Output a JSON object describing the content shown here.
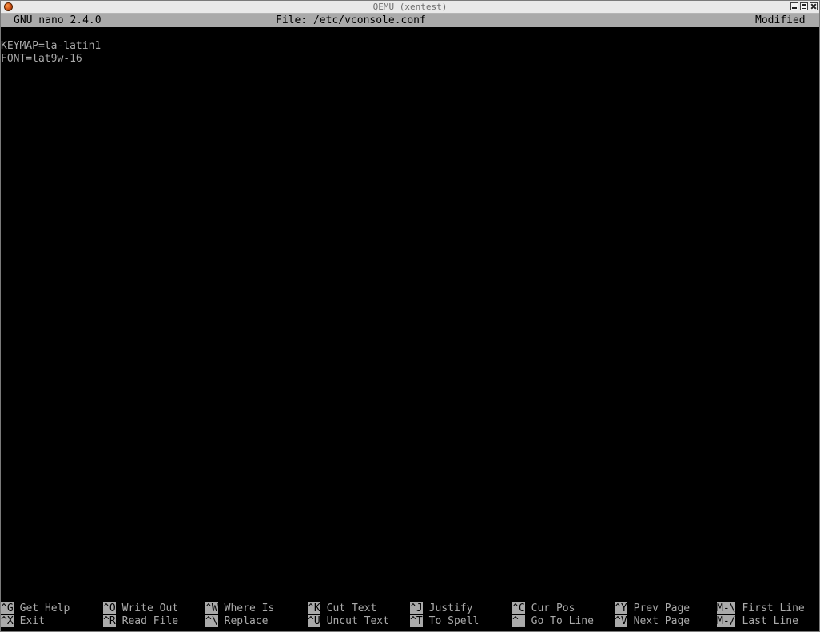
{
  "window": {
    "title": "QEMU (xentest)"
  },
  "nano": {
    "version": "GNU nano 2.4.0",
    "file": "File: /etc/vconsole.conf",
    "status": "Modified"
  },
  "content": {
    "lines": [
      "",
      "KEYMAP=la-latin1",
      "FONT=lat9w-16"
    ]
  },
  "shortcuts": {
    "row1": [
      {
        "key": "^G",
        "label": "Get Help"
      },
      {
        "key": "^O",
        "label": "Write Out"
      },
      {
        "key": "^W",
        "label": "Where Is"
      },
      {
        "key": "^K",
        "label": "Cut Text"
      },
      {
        "key": "^J",
        "label": "Justify"
      },
      {
        "key": "^C",
        "label": "Cur Pos"
      },
      {
        "key": "^Y",
        "label": "Prev Page"
      },
      {
        "key": "M-\\",
        "label": "First Line"
      }
    ],
    "row2": [
      {
        "key": "^X",
        "label": "Exit"
      },
      {
        "key": "^R",
        "label": "Read File"
      },
      {
        "key": "^\\",
        "label": "Replace"
      },
      {
        "key": "^U",
        "label": "Uncut Text"
      },
      {
        "key": "^T",
        "label": "To Spell"
      },
      {
        "key": "^_",
        "label": "Go To Line"
      },
      {
        "key": "^V",
        "label": "Next Page"
      },
      {
        "key": "M-/",
        "label": "Last Line"
      }
    ]
  },
  "colors": {
    "terminal_bg": "#000000",
    "terminal_fg": "#aaaaaa",
    "inverse_bg": "#aaaaaa"
  }
}
